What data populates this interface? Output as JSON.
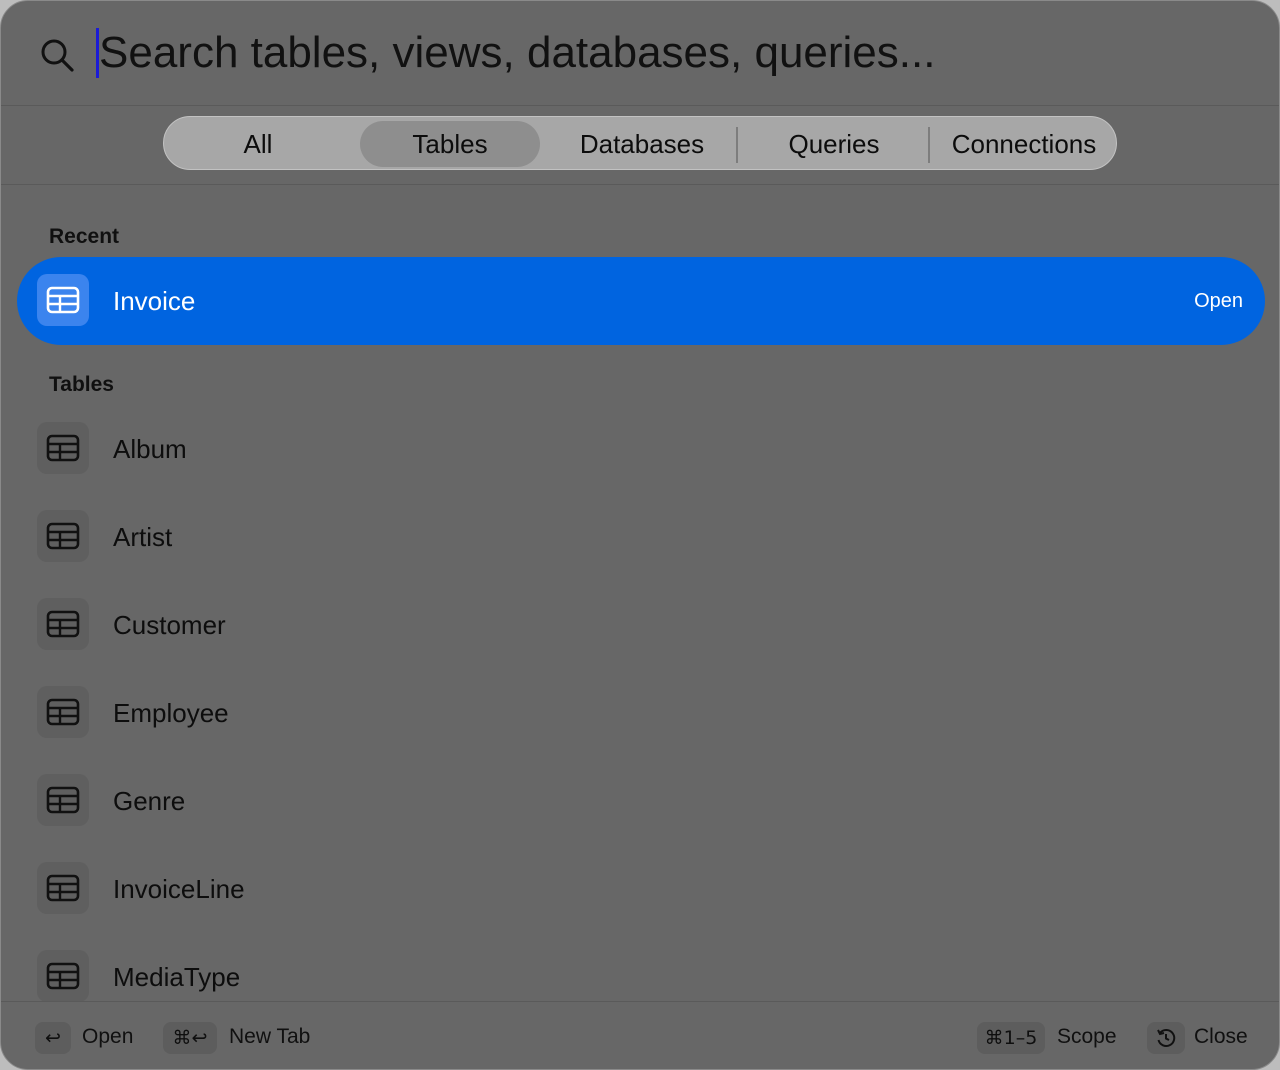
{
  "search": {
    "placeholder": "Search tables, views, databases, queries..."
  },
  "scopes": [
    {
      "label": "All",
      "active": false
    },
    {
      "label": "Tables",
      "active": true
    },
    {
      "label": "Databases",
      "active": false
    },
    {
      "label": "Queries",
      "active": false
    },
    {
      "label": "Connections",
      "active": false
    }
  ],
  "recent": {
    "header": "Recent",
    "items": [
      {
        "label": "Invoice",
        "action": "Open",
        "icon": "table-icon",
        "selected": true
      }
    ]
  },
  "tables": {
    "header": "Tables",
    "items": [
      {
        "label": "Album",
        "icon": "table-icon"
      },
      {
        "label": "Artist",
        "icon": "table-icon"
      },
      {
        "label": "Customer",
        "icon": "table-icon"
      },
      {
        "label": "Employee",
        "icon": "table-icon"
      },
      {
        "label": "Genre",
        "icon": "table-icon"
      },
      {
        "label": "InvoiceLine",
        "icon": "table-icon"
      },
      {
        "label": "MediaType",
        "icon": "table-icon"
      }
    ]
  },
  "footer": {
    "open_key": "↩",
    "open_label": "Open",
    "newtab_key": "⌘↩",
    "newtab_label": "New Tab",
    "scope_key": "⌘1–5",
    "scope_label": "Scope",
    "close_icon": "history-icon",
    "close_label": "Close"
  },
  "colors": {
    "accent": "#0064e0",
    "panel_bg": "#676767"
  }
}
